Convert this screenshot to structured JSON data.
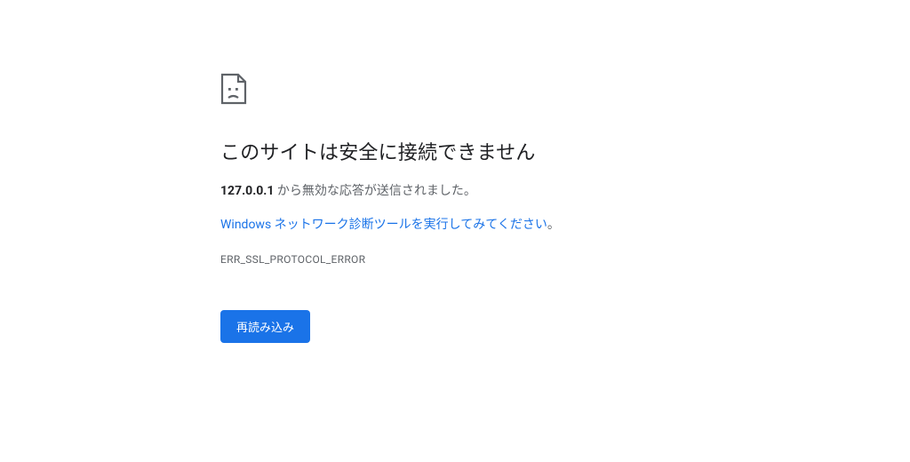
{
  "title": "このサイトは安全に接続できません",
  "host": "127.0.0.1",
  "message_suffix": " から無効な応答が送信されました。",
  "suggestion_link_text": "Windows ネットワーク診断ツールを実行してみてください",
  "suggestion_suffix": "。",
  "error_code": "ERR_SSL_PROTOCOL_ERROR",
  "reload_label": "再読み込み"
}
